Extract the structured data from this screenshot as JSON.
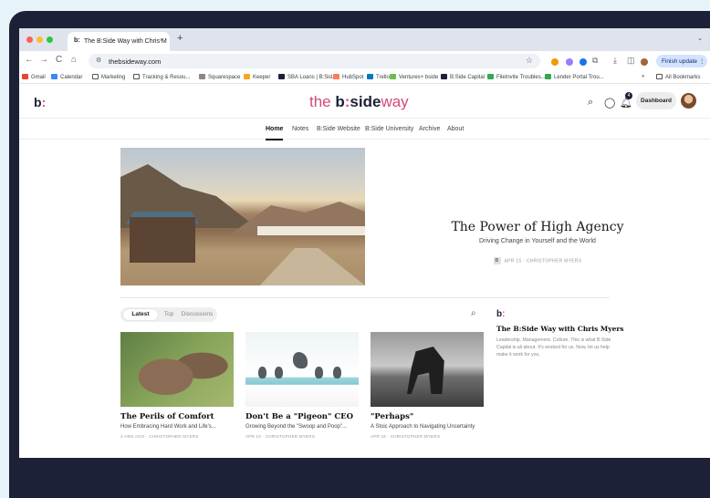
{
  "browser": {
    "tab_favicon": "b:",
    "tab_title": "The B:Side Way with Chris M",
    "tab_close": "×",
    "new_tab": "+",
    "tab_menu": "⌄",
    "nav": {
      "back": "←",
      "forward": "→",
      "reload": "C",
      "home": "⌂"
    },
    "url": "thebsideway.com",
    "star": "☆",
    "download": "⤓",
    "sidepanel": "◫",
    "finish_update": "Finish update  ⋮",
    "accent_color": "#d3e3fd"
  },
  "bookmarks": [
    {
      "label": "Gmail",
      "icon": "gmail-icon",
      "color": "#ea4335"
    },
    {
      "label": "Calendar",
      "icon": "calendar-icon",
      "color": "#4285f4"
    },
    {
      "label": "Marketing",
      "icon": "folder-icon",
      "color": "#ffffff"
    },
    {
      "label": "Tracking & Resou...",
      "icon": "folder-icon",
      "color": "#ffffff"
    },
    {
      "label": "Squarespace",
      "icon": "squarespace-icon",
      "color": "#888888"
    },
    {
      "label": "Keeper",
      "icon": "keeper-icon",
      "color": "#f5a623"
    },
    {
      "label": "SBA Loans | B:Sid...",
      "icon": "bside-icon",
      "color": "#1d2137"
    },
    {
      "label": "HubSpot",
      "icon": "hubspot-icon",
      "color": "#ff7a59"
    },
    {
      "label": "Trello",
      "icon": "trello-icon",
      "color": "#0079bf"
    },
    {
      "label": "Ventures+ bside",
      "icon": "ventures-icon",
      "color": "#6cc04a"
    },
    {
      "label": "B:Side Capital",
      "icon": "bside-icon",
      "color": "#1d2137"
    },
    {
      "label": "FileInvite Troubles...",
      "icon": "fileinvite-icon",
      "color": "#34a853"
    },
    {
      "label": "Lender Portal Trou...",
      "icon": "lender-icon",
      "color": "#34a853"
    }
  ],
  "bookmarks_more": "»",
  "all_bookmarks": "All Bookmarks",
  "site": {
    "logo_b": "b",
    "logo_colon": ":",
    "wordmark_the": "the ",
    "wordmark_b": "b",
    "wordmark_colon": ":",
    "wordmark_side": "side",
    "wordmark_way": "way",
    "notification_count": "4",
    "dashboard_label": "Dashboard",
    "brand_pink": "#e24b7c",
    "brand_navy": "#1d2137"
  },
  "nav": [
    {
      "label": "Home",
      "active": true
    },
    {
      "label": "Notes",
      "active": false
    },
    {
      "label": "B:Side Website",
      "active": false
    },
    {
      "label": "B:Side University",
      "active": false
    },
    {
      "label": "Archive",
      "active": false
    },
    {
      "label": "About",
      "active": false
    }
  ],
  "hero": {
    "title": "The Power of High Agency",
    "subtitle": "Driving Change in Yourself and the World",
    "meta_icon": "B",
    "meta": "APR 15 · CHRISTOPHER MYERS"
  },
  "feed_tabs": [
    "Latest",
    "Top",
    "Discussions"
  ],
  "posts": [
    {
      "title": "The Perils of Comfort",
      "subtitle": "How Embracing Hard Work and Life's...",
      "meta": "2 HRS AGO · CHRISTOPHER MYERS"
    },
    {
      "title": "Don't Be a \"Pigeon\" CEO",
      "subtitle": "Growing Beyond the \"Swoop and Poop\"...",
      "meta": "APR 18 · CHRISTOPHER MYERS"
    },
    {
      "title": "\"Perhaps\"",
      "subtitle": "A Stoic Approach to Navigating Uncertainty",
      "meta": "APR 16 · CHRISTOPHER MYERS"
    }
  ],
  "about": {
    "title": "The B:Side Way with Chris Myers",
    "description": "Leadership. Management. Culture. This is what B:Side Capital is all about. It's worked for us. Now, let us help make it work for you."
  }
}
